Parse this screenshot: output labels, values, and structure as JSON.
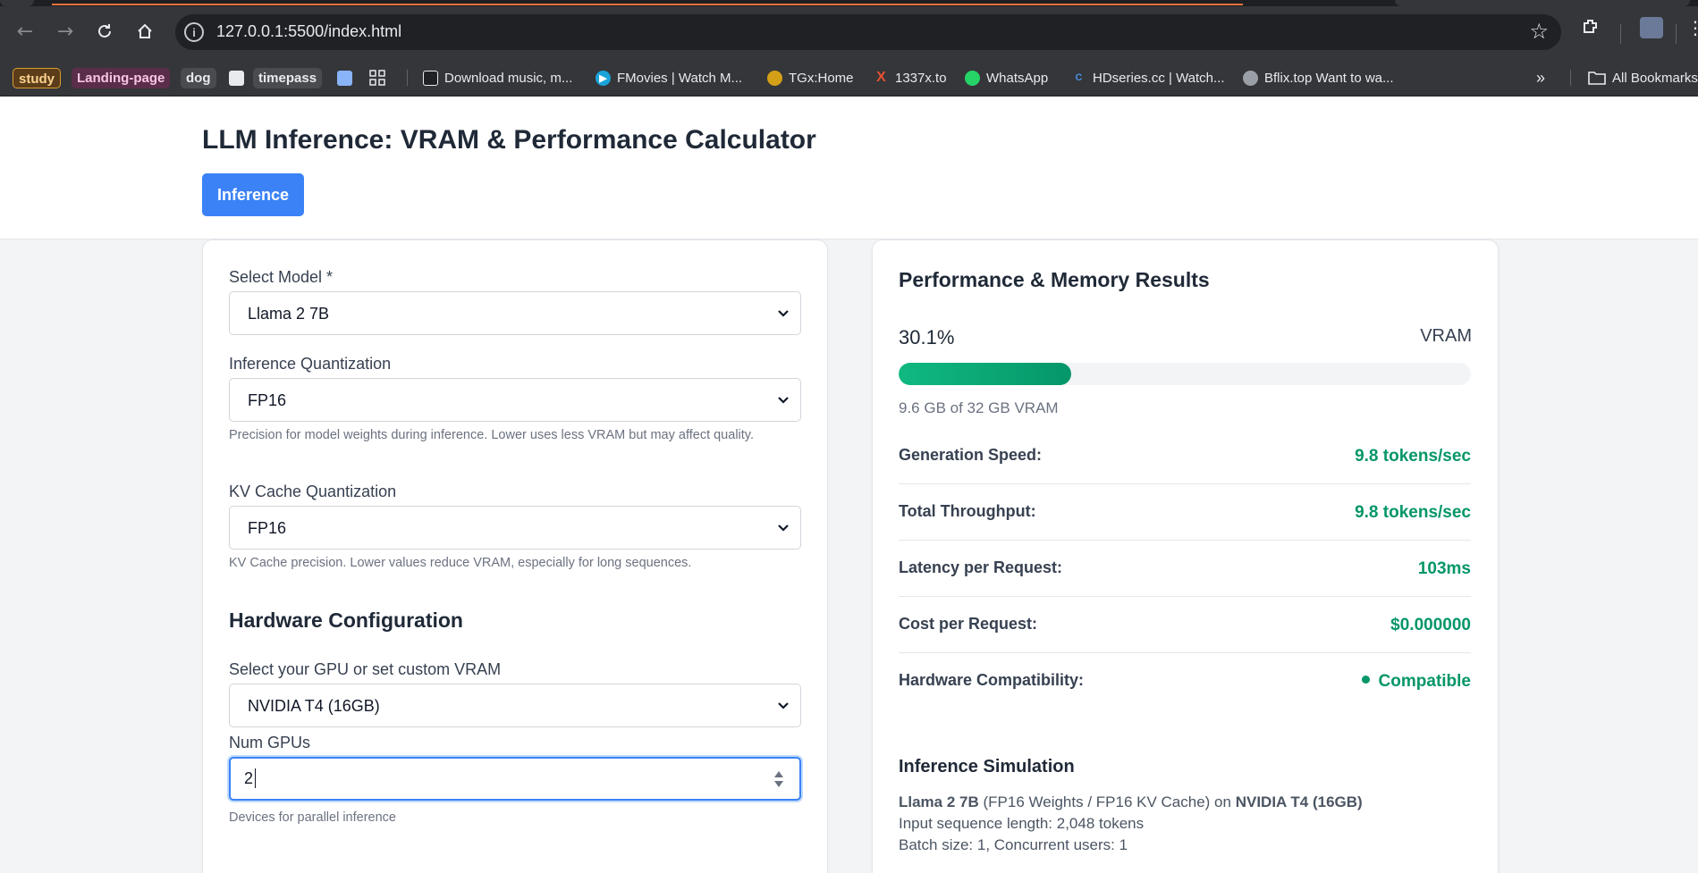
{
  "browser": {
    "url": "127.0.0.1:5500/index.html",
    "bookmarks": [
      {
        "label": "study"
      },
      {
        "label": "Landing-page"
      },
      {
        "label": "dog"
      },
      {
        "label": "timepass"
      },
      {
        "label": "Download music, m..."
      },
      {
        "label": "FMovies | Watch M..."
      },
      {
        "label": "TGx:Home"
      },
      {
        "label": "1337x.to"
      },
      {
        "label": "WhatsApp"
      },
      {
        "label": "HDseries.cc | Watch..."
      },
      {
        "label": "Bflix.top Want to wa..."
      }
    ],
    "all_bookmarks": "All Bookmarks"
  },
  "header": {
    "title": "LLM Inference: VRAM & Performance Calculator",
    "tab_label": "Inference"
  },
  "form": {
    "model_label": "Select Model *",
    "model_value": "Llama 2 7B",
    "inference_quant_label": "Inference Quantization",
    "inference_quant_value": "FP16",
    "inference_quant_help": "Precision for model weights during inference. Lower uses less VRAM but may affect quality.",
    "kv_quant_label": "KV Cache Quantization",
    "kv_quant_value": "FP16",
    "kv_quant_help": "KV Cache precision. Lower values reduce VRAM, especially for long sequences.",
    "hardware_heading": "Hardware Configuration",
    "gpu_label": "Select your GPU or set custom VRAM",
    "gpu_value": "NVIDIA T4 (16GB)",
    "num_gpus_label": "Num GPUs",
    "num_gpus_value": "2",
    "num_gpus_help": "Devices for parallel inference"
  },
  "results": {
    "title": "Performance & Memory Results",
    "vram_percent": "30.1%",
    "vram_fraction": 0.301,
    "vram_label": "VRAM",
    "vram_sub": "9.6 GB of 32 GB VRAM",
    "metrics": [
      {
        "key": "Generation Speed:",
        "value": "9.8 tokens/sec"
      },
      {
        "key": "Total Throughput:",
        "value": "9.8 tokens/sec"
      },
      {
        "key": "Latency per Request:",
        "value": "103ms"
      },
      {
        "key": "Cost per Request:",
        "value": "$0.000000"
      },
      {
        "key": "Hardware Compatibility:",
        "value": "Compatible"
      }
    ],
    "simulation": {
      "heading": "Inference Simulation",
      "model": "Llama 2 7B",
      "precision": " (FP16 Weights / FP16 KV Cache) on ",
      "gpu": "NVIDIA T4 (16GB)",
      "input_len": "Input sequence length: 2,048 tokens",
      "batch": "Batch size: 1, Concurrent users: 1"
    }
  },
  "colors": {
    "accent": "#3b82f6",
    "success": "#059669",
    "bar_start": "#10b981"
  }
}
